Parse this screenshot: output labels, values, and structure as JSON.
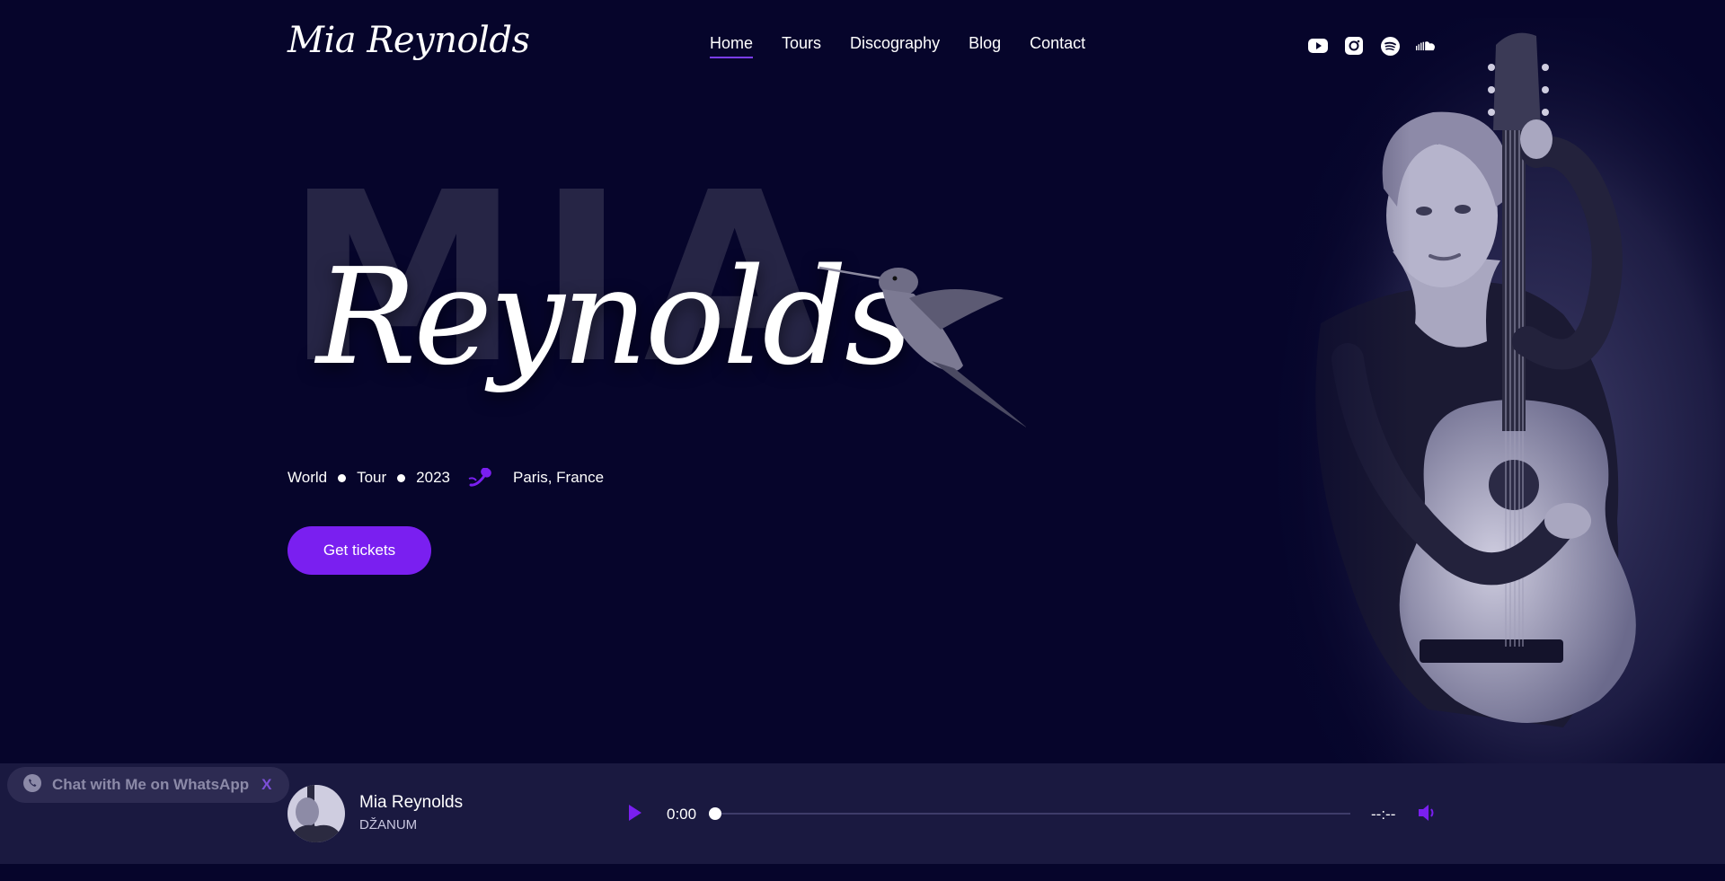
{
  "header": {
    "logo": "Mia Reynolds",
    "nav": [
      {
        "label": "Home",
        "active": true
      },
      {
        "label": "Tours"
      },
      {
        "label": "Discography"
      },
      {
        "label": "Blog"
      },
      {
        "label": "Contact"
      }
    ],
    "socials": [
      "youtube-icon",
      "instagram-icon",
      "spotify-icon",
      "soundcloud-icon"
    ]
  },
  "hero": {
    "big_word": "MIA",
    "script_word": "Reynolds",
    "meta": {
      "w1": "World",
      "w2": "Tour",
      "w3": "2023",
      "location": "Paris, France"
    },
    "cta": "Get tickets"
  },
  "player": {
    "artist": "Mia Reynolds",
    "track": "DŽANUM",
    "current_time": "0:00",
    "duration": "--:--",
    "progress": 0
  },
  "whatsapp": {
    "label": "Chat with Me on WhatsApp",
    "close": "X"
  },
  "colors": {
    "background": "#06052b",
    "accent": "#7a1ff0",
    "player_bg": "#1a1940"
  }
}
